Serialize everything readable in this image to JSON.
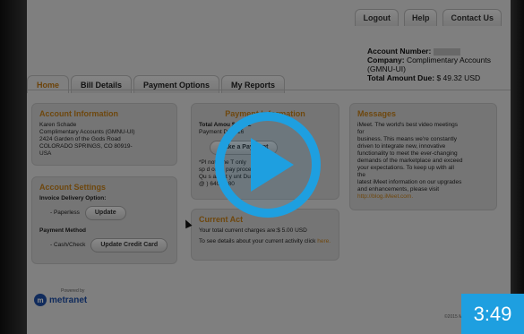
{
  "topnav": {
    "items": [
      "Logout",
      "Help",
      "Contact Us"
    ]
  },
  "account": {
    "number_label": "Account Number:",
    "company_label": "Company:",
    "company_value": "Complimentary Accounts (GMNU-UI)",
    "total_label": "Total Amount Due:",
    "total_value": "$ 49.32 USD"
  },
  "tabs": [
    "Home",
    "Bill Details",
    "Payment Options",
    "My Reports"
  ],
  "account_info": {
    "title": "Account Information",
    "lines": [
      "Karen Schade",
      "Complimentary Accounts (GMNU-UI)",
      "2424 Garden of the Gods Road",
      "COLORADO SPRINGS, CO  80919-",
      "USA"
    ]
  },
  "payment_info": {
    "title": "Payment Information",
    "total_label": "Total Amou",
    "total_value": "$ 49.32",
    "date_label": "Payment D",
    "date_value": "/2016",
    "button": "Make a Payment",
    "note_lines": [
      "*Pl     note the T           only",
      "sp        d once pay           processe",
      "Qu        s about y       unt Due? Call",
      "@         ) 640-0880"
    ]
  },
  "messages": {
    "title": "Messages",
    "lines": [
      "iMeet. The world's best video meetings",
      "for",
      "business. This means we're constantly",
      "driven to integrate new, innovative",
      "functionality to meet the ever-changing",
      "demands of the marketplace and exceed",
      "your expectations. To keep up with all",
      "the",
      "latest iMeet information on our upgrades",
      "and enhancements, please visit",
      "http://blog.iMeet.com."
    ]
  },
  "account_settings": {
    "title": "Account Settings",
    "invoice_label": "Invoice Delivery Option:",
    "invoice_value": "- Paperless",
    "update_button": "Update",
    "payment_method_label": "Payment Method",
    "payment_method_value": "- Cash/Check",
    "update_cc_button": "Update Credit Card"
  },
  "current_activity": {
    "title": "Current Act",
    "line1": "Your total current charges are:$ 5.00 USD",
    "line2_prefix": "To see details about your current activity click ",
    "line2_link": "here."
  },
  "footer": {
    "powered_by": "Powered by",
    "logo_text": "metranet",
    "copyright": "©2015 MetraTech Corp. All ri"
  },
  "video": {
    "timecode": "3:49"
  }
}
